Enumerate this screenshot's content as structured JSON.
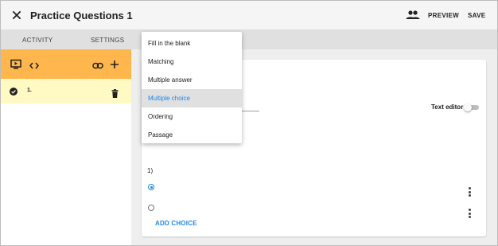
{
  "header": {
    "title": "Practice Questions 1",
    "preview_label": "PREVIEW",
    "save_label": "SAVE"
  },
  "tabs": [
    {
      "label": "ACTIVITY"
    },
    {
      "label": "SETTINGS"
    }
  ],
  "sidebar": {
    "items": [
      {
        "label": "1.",
        "status": "complete"
      }
    ]
  },
  "editor": {
    "text_editor_label": "Text editor",
    "text_editor_enabled": false,
    "question_number": "1)",
    "choices": [
      {
        "selected": true
      },
      {
        "selected": false
      }
    ],
    "add_choice_label": "ADD CHOICE"
  },
  "question_type_menu": {
    "items": [
      {
        "label": "Fill in the blank"
      },
      {
        "label": "Matching"
      },
      {
        "label": "Multiple answer"
      },
      {
        "label": "Multiple choice"
      },
      {
        "label": "Ordering"
      },
      {
        "label": "Passage"
      }
    ],
    "selected": "Multiple choice"
  },
  "colors": {
    "accent": "#1e88e5",
    "toolbar": "#ffb74d",
    "active_item": "#fff9c4"
  }
}
